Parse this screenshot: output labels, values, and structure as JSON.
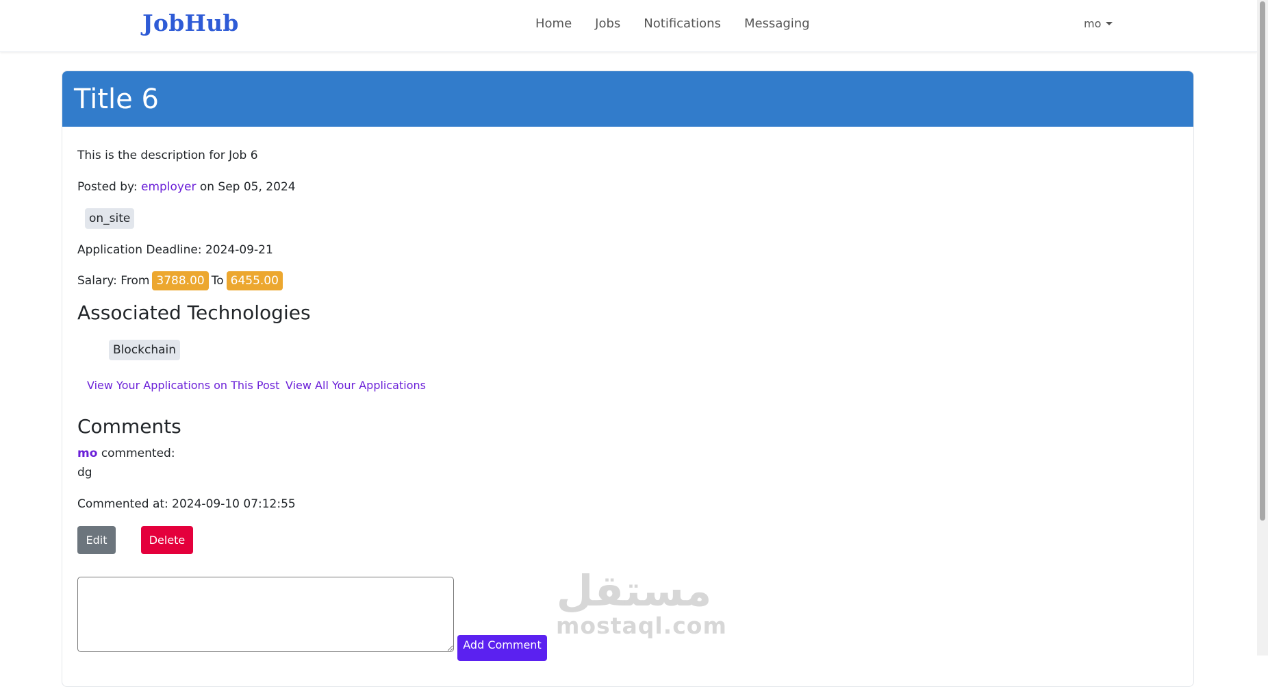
{
  "nav": {
    "brand": "JobHub",
    "links": [
      "Home",
      "Jobs",
      "Notifications",
      "Messaging"
    ],
    "user": "mo"
  },
  "job": {
    "title": "Title 6",
    "description": "This is the description for Job 6",
    "posted_by_prefix": "Posted by:",
    "employer": "employer",
    "posted_on": "on Sep 05, 2024",
    "work_type": "on_site",
    "deadline_label": "Application Deadline:",
    "deadline": "2024-09-21",
    "salary_label": "Salary: From",
    "salary_from": "3788.00",
    "salary_to_label": "To",
    "salary_to": "6455.00"
  },
  "technologies": {
    "heading": "Associated Technologies",
    "items": [
      "Blockchain"
    ]
  },
  "links": {
    "view_post_applications": "View Your Applications on This Post",
    "view_all_applications": "View All Your Applications"
  },
  "comments": {
    "heading": "Comments",
    "items": [
      {
        "author": "mo",
        "verb": "commented:",
        "text": "dg",
        "timestamp_label": "Commented at:",
        "timestamp": "2024-09-10 07:12:55",
        "edit_label": "Edit",
        "delete_label": "Delete"
      }
    ],
    "new_comment_value": "",
    "add_label": "Add Comment"
  },
  "watermark": {
    "arabic": "مستقل",
    "latin": "mostaql.com"
  },
  "colors": {
    "brand": "#2e5bd6",
    "header": "#327ccb",
    "link": "#6a1fd8",
    "salary_badge": "#eca72f",
    "delete": "#e4003c",
    "edit": "#6c757d",
    "add": "#5b21f0"
  }
}
